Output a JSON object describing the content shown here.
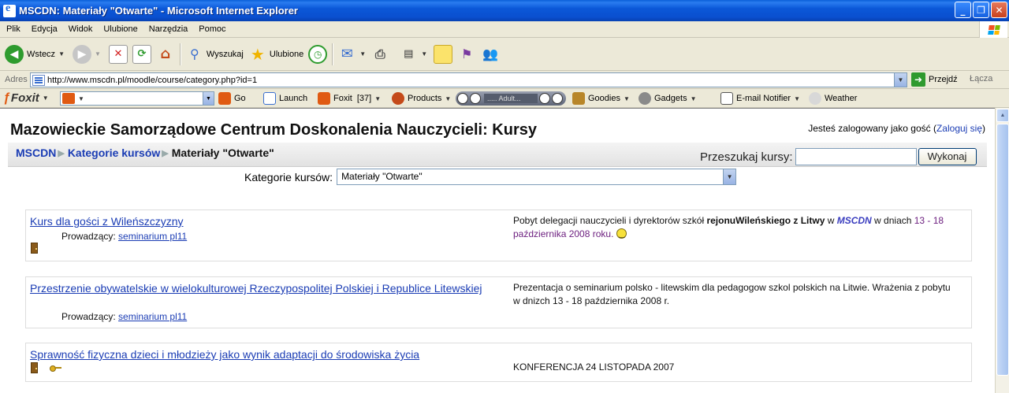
{
  "window": {
    "title": "MSCDN: Materiały \"Otwarte\" - Microsoft Internet Explorer",
    "buttons": [
      "_",
      "❐",
      "✕"
    ]
  },
  "menu": [
    "Plik",
    "Edycja",
    "Widok",
    "Ulubione",
    "Narzędzia",
    "Pomoc"
  ],
  "toolbar": {
    "back": "Wstecz",
    "search": "Wyszukaj",
    "favorites": "Ulubione"
  },
  "address": {
    "label": "Adres",
    "url": "http://www.mscdn.pl/moodle/course/category.php?id=1",
    "go": "Przejdź",
    "links": "Łącza"
  },
  "foxit": {
    "brand": "Foxit",
    "go": "Go",
    "launch": "Launch",
    "foxit_count": "Foxit",
    "count": "[37]",
    "products": "Products",
    "player_text": "..... Adult...",
    "goodies": "Goodies",
    "gadgets": "Gadgets",
    "email": "E-mail Notifier",
    "weather": "Weather"
  },
  "page": {
    "header": "Mazowieckie Samorządowe Centrum Doskonalenia Nauczycieli: Kursy",
    "login_prefix": "Jesteś zalogowany jako gość (",
    "login_link": "Zaloguj się",
    "login_suffix": ")",
    "breadcrumb": [
      "MSCDN",
      "Kategorie kursów",
      "Materiały \"Otwarte\""
    ],
    "search_label": "Przeszukaj kursy:",
    "search_button": "Wykonaj",
    "category_label": "Kategorie kursów:",
    "category_selected": "Materiały \"Otwarte\""
  },
  "courses": [
    {
      "name": "Kurs dla gości z Wileńszczyzny",
      "teacher_label": "Prowadzący:",
      "teacher": "seminarium pl11",
      "summary_1": "Pobyt delegacji nauczycieli i dyrektorów szkół ",
      "summary_bold": "rejonuWileńskiego z Litwy",
      "summary_2": " w ",
      "summary_link": "MSCDN",
      "summary_3": " w dniach ",
      "summary_date": "13 - 18 października 2008 roku."
    },
    {
      "name": "Przestrzenie obywatelskie w wielokulturowej Rzeczypospolitej Polskiej i Republice Litewskiej",
      "teacher_label": "Prowadzący:",
      "teacher": "seminarium pl11",
      "summary": "Prezentacja o seminarium polsko - litewskim dla pedagogow szkol polskich na Litwie. Wrażenia z pobytu w dnizch 13 - 18 października 2008 r."
    },
    {
      "name": "Sprawność fizyczna dzieci i młodzieży jako wynik adaptacji do środowiska życia",
      "summary": "KONFERENCJA 24 LISTOPADA 2007"
    }
  ]
}
